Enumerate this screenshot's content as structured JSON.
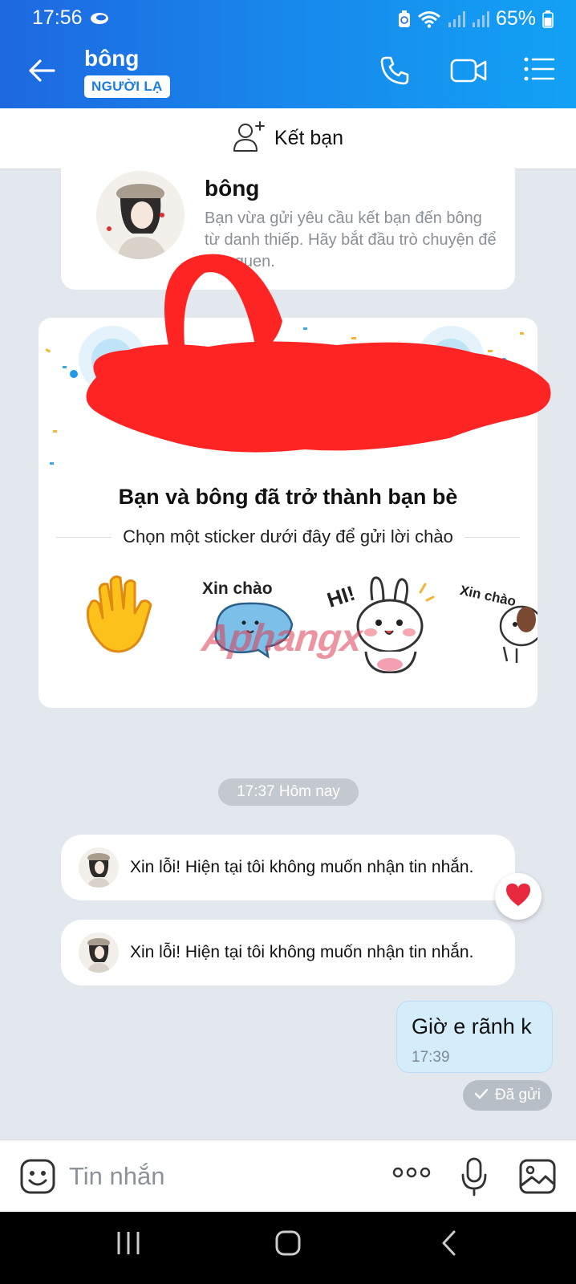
{
  "status_bar": {
    "time": "17:56",
    "battery": "65%"
  },
  "header": {
    "name": "bông",
    "badge": "NGƯỜI LẠ",
    "icons": [
      "back-arrow-icon",
      "phone-icon",
      "video-camera-icon",
      "list-menu-icon"
    ]
  },
  "add_friend": {
    "label": "Kết bạn",
    "icon": "add-user-icon"
  },
  "profile_card": {
    "name": "bông",
    "description": "Bạn vừa gửi yêu cầu kết bạn đến bông từ danh thiếp. Hãy bắt đầu trò chuyện để làm quen."
  },
  "friend_card": {
    "title": "Bạn và bông đã trở thành bạn bè",
    "subtitle": "Chọn một sticker dưới đây để gửi lời chào",
    "stickers": [
      {
        "name": "waving-hand-sticker",
        "text": ""
      },
      {
        "name": "cat-sticker",
        "text": "Xin chào"
      },
      {
        "name": "bunny-sticker",
        "text": "HI!"
      },
      {
        "name": "dog-sticker",
        "text": "Xin chào"
      }
    ]
  },
  "watermark": "Aphangx",
  "conversation": {
    "time_divider": "17:37 Hôm nay",
    "incoming": [
      {
        "text": "Xin lỗi! Hiện tại tôi không muốn nhận tin nhắn.",
        "reaction": "heart"
      },
      {
        "text": "Xin lỗi! Hiện tại tôi không muốn nhận tin nhắn.",
        "reaction": ""
      }
    ],
    "outgoing": {
      "text": "Giờ e rãnh k",
      "time": "17:39",
      "status": "Đã gửi"
    }
  },
  "composer": {
    "placeholder": "Tin nhắn"
  },
  "colors": {
    "header_start": "#1e68e0",
    "header_end": "#12a1f4",
    "chat_bg": "#e3e7ee",
    "outgoing_bubble": "#d5ecfb",
    "redaction": "#ff2020"
  }
}
